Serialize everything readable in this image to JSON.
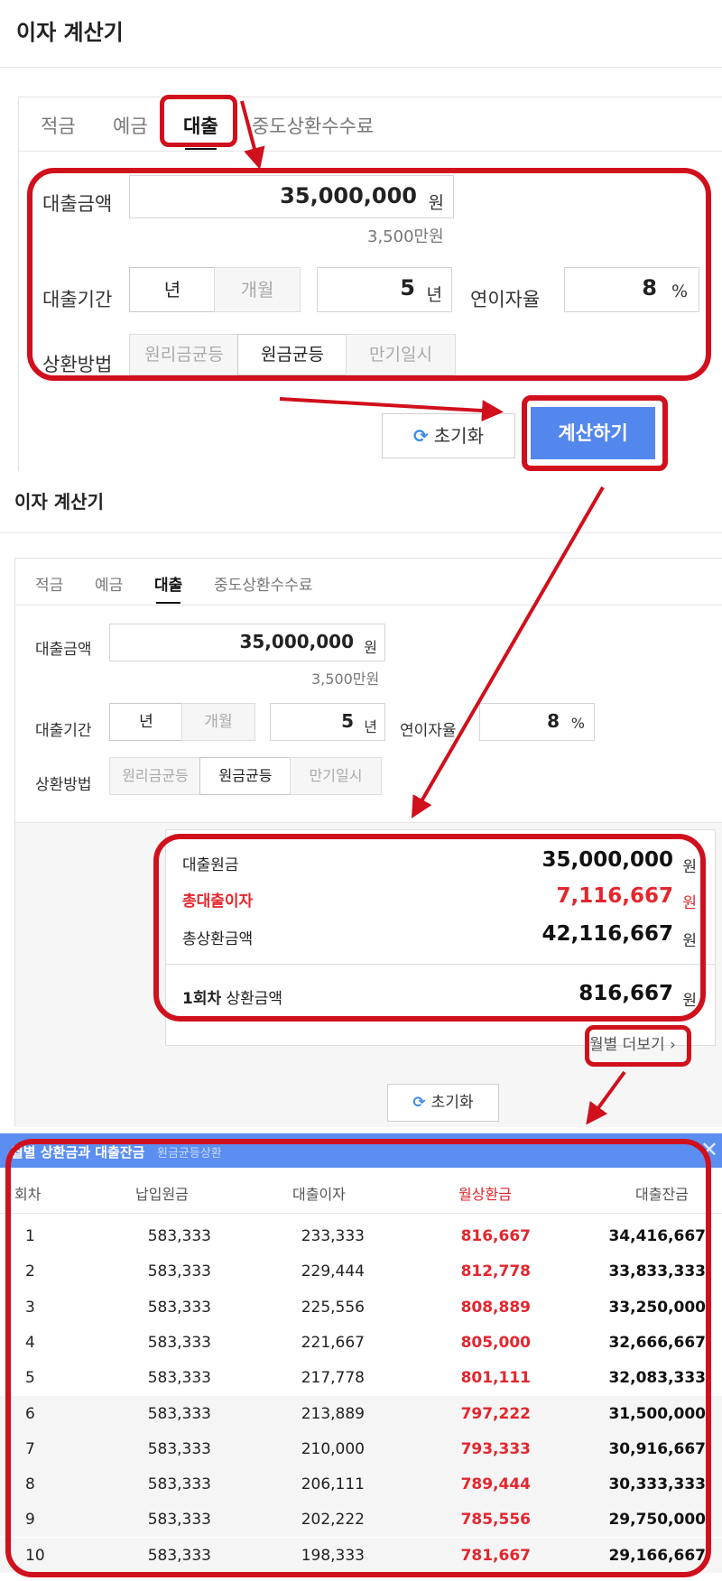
{
  "panel1": {
    "title": "이자 계산기",
    "tabs": [
      "적금",
      "예금",
      "대출",
      "중도상환수수료"
    ],
    "amount_label": "대출금액",
    "amount_value": "35,000,000",
    "amount_unit": "원",
    "amount_hint": "3,500만원",
    "period_label": "대출기간",
    "period_options": [
      "년",
      "개월"
    ],
    "period_value": "5",
    "period_unit": "년",
    "rate_label": "연이자율",
    "rate_value": "8",
    "rate_unit": "%",
    "method_label": "상환방법",
    "method_options": [
      "원리금균등",
      "원금균등",
      "만기일시"
    ],
    "reset_label": "초기화",
    "calc_label": "계산하기"
  },
  "panel2": {
    "title": "이자 계산기",
    "tabs": [
      "적금",
      "예금",
      "대출",
      "중도상환수수료"
    ],
    "amount_label": "대출금액",
    "amount_value": "35,000,000",
    "amount_unit": "원",
    "amount_hint": "3,500만원",
    "period_label": "대출기간",
    "period_options": [
      "년",
      "개월"
    ],
    "period_value": "5",
    "period_unit": "년",
    "rate_label": "연이자율",
    "rate_value": "8",
    "rate_unit": "%",
    "method_label": "상환방법",
    "method_options": [
      "원리금균등",
      "원금균등",
      "만기일시"
    ],
    "results": [
      {
        "label": "대출원금",
        "value": "35,000,000",
        "unit": "원"
      },
      {
        "label": "총대출이자",
        "value": "7,116,667",
        "unit": "원"
      },
      {
        "label": "총상환금액",
        "value": "42,116,667",
        "unit": "원"
      },
      {
        "label": "1회차 상환금액",
        "value": "816,667",
        "unit": "원"
      }
    ],
    "first_label_bold": "1회차",
    "first_label_rest": " 상환금액",
    "more_label": "월별 더보기",
    "reset_label": "초기화"
  },
  "table": {
    "title": "월별 상환금과 대출잔금",
    "subtitle": "원금균등상환",
    "close": "✕",
    "columns": [
      "회차",
      "납입원금",
      "대출이자",
      "월상환금",
      "대출잔금"
    ],
    "rows": [
      [
        "1",
        "583,333",
        "233,333",
        "816,667",
        "34,416,667"
      ],
      [
        "2",
        "583,333",
        "229,444",
        "812,778",
        "33,833,333"
      ],
      [
        "3",
        "583,333",
        "225,556",
        "808,889",
        "33,250,000"
      ],
      [
        "4",
        "583,333",
        "221,667",
        "805,000",
        "32,666,667"
      ],
      [
        "5",
        "583,333",
        "217,778",
        "801,111",
        "32,083,333"
      ],
      [
        "6",
        "583,333",
        "213,889",
        "797,222",
        "31,500,000"
      ],
      [
        "7",
        "583,333",
        "210,000",
        "793,333",
        "30,916,667"
      ],
      [
        "8",
        "583,333",
        "206,111",
        "789,444",
        "30,333,333"
      ],
      [
        "9",
        "583,333",
        "202,222",
        "785,556",
        "29,750,000"
      ],
      [
        "10",
        "583,333",
        "198,333",
        "781,667",
        "29,166,667"
      ]
    ]
  },
  "colors": {
    "accent_blue": "#5487ee",
    "highlight_red": "#d0101c",
    "value_red": "#e3262e"
  }
}
